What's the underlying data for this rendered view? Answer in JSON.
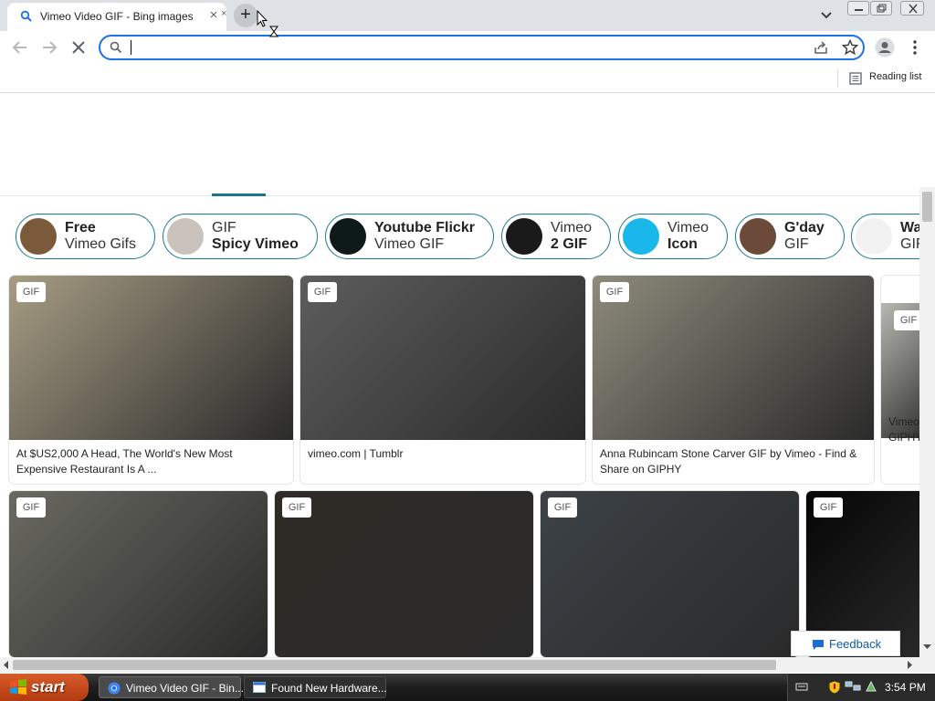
{
  "browser": {
    "tab": {
      "title": "Vimeo Video GIF - Bing images",
      "close": "×"
    },
    "second_tab_close": "×",
    "new_tab": "+",
    "omnibox": {
      "value": "",
      "placeholder": ""
    },
    "bookmarks": {
      "reading_list": "Reading list"
    }
  },
  "chips": [
    {
      "line1": "Free",
      "line1_bold": true,
      "line2": "Vimeo Gifs",
      "line2_bold": false,
      "thumb_color": "#7a5a3a"
    },
    {
      "line1": "GIF",
      "line1_bold": false,
      "line2": "Spicy Vimeo",
      "line2_bold": true,
      "thumb_color": "#c9c2bd"
    },
    {
      "line1": "Youtube Flickr",
      "line1_bold": true,
      "line2": "Vimeo GIF",
      "line2_bold": false,
      "thumb_color": "#0e1a1a"
    },
    {
      "line1": "Vimeo",
      "line1_bold": false,
      "line2": "2 GIF",
      "line2_bold": true,
      "thumb_color": "#1a1a1a"
    },
    {
      "line1": "Vimeo",
      "line1_bold": false,
      "line2": "Icon",
      "line2_bold": true,
      "thumb_color": "#1ab7ea"
    },
    {
      "line1": "G'day",
      "line1_bold": true,
      "line2": "GIF",
      "line2_bold": false,
      "thumb_color": "#6b4a3a"
    },
    {
      "line1": "Wa",
      "line1_bold": true,
      "line2": "GIF",
      "line2_bold": false,
      "thumb_color": "#f2f2f2"
    }
  ],
  "results_row1": [
    {
      "badge": "GIF",
      "caption": "At $US2,000 A Head, The World's New Most Expensive Restaurant Is A ...",
      "image_color": "#a79d84"
    },
    {
      "badge": "GIF",
      "caption": "vimeo.com | Tumblr",
      "image_color": "#5d5d5d"
    },
    {
      "badge": "GIF",
      "caption": "Anna Rubincam Stone Carver GIF by Vimeo - Find & Share on GIPHY",
      "image_color": "#8e8a7c"
    },
    {
      "badge": "GIF",
      "caption": "Vimeo GIPHY",
      "image_color": "#b8b8b2"
    }
  ],
  "results_row2": [
    {
      "badge": "GIF",
      "image_color": "#6a6a62"
    },
    {
      "badge": "GIF",
      "image_color": "#2f2b26"
    },
    {
      "badge": "GIF",
      "image_color": "#3c4247"
    },
    {
      "badge": "GIF",
      "image_color": "#050505"
    }
  ],
  "feedback": "Feedback",
  "taskbar": {
    "start": "start",
    "items": [
      {
        "label": "Vimeo Video GIF - Bin..."
      },
      {
        "label": "Found New Hardware..."
      }
    ],
    "clock": "3:54 PM"
  },
  "colors": {
    "accent": "#1a7590",
    "chip_border": "#1b7a90",
    "omnibox_focus": "#1a73e8"
  }
}
